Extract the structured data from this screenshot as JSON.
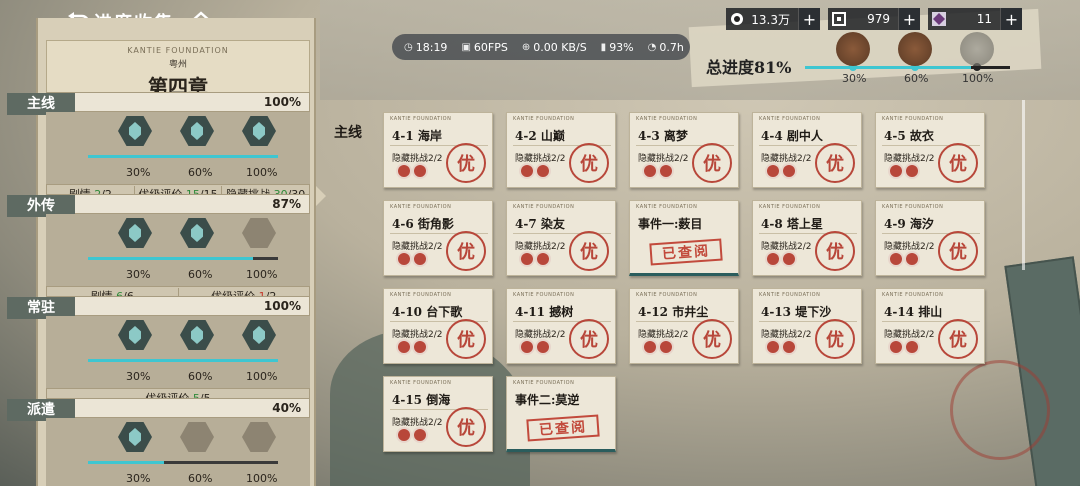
{
  "header": {
    "title": "进度收集",
    "back_icon": "back-arrow-icon",
    "home_icon": "home-icon"
  },
  "status": {
    "time": "18:19",
    "fps": "60FPS",
    "net": "0.00 KB/S",
    "battery": "93%",
    "ping": "0.7h"
  },
  "currencies": [
    {
      "icon": "coin-icon",
      "value": "13.3万",
      "plus": "+"
    },
    {
      "icon": "ticket-icon",
      "value": "979",
      "plus": "+"
    },
    {
      "icon": "crystal-icon",
      "value": "11",
      "plus": "+"
    }
  ],
  "total": {
    "label": "总进度81%",
    "progress": 0.81,
    "marks": [
      "30%",
      "60%",
      "100%"
    ]
  },
  "chapter": {
    "en": "KANTIE FOUNDATION",
    "region": "粤州",
    "title": "第四章"
  },
  "sections": [
    {
      "title": "主线",
      "pct": "100%",
      "marks": [
        "30%",
        "60%",
        "100%"
      ],
      "hex_on": [
        true,
        true,
        true
      ],
      "fill": 1.0,
      "stats": [
        {
          "label": "剧情 ",
          "val": "2",
          "tot": "/2"
        },
        {
          "label": "优级评价 ",
          "val": "15",
          "tot": "/15"
        },
        {
          "label": "隐藏挑战 ",
          "val": "30",
          "tot": "/30"
        }
      ]
    },
    {
      "title": "外传",
      "pct": "87%",
      "marks": [
        "30%",
        "60%",
        "100%"
      ],
      "hex_on": [
        true,
        true,
        false
      ],
      "fill": 0.87,
      "stats": [
        {
          "label": "剧情 ",
          "val": "6",
          "tot": "/6"
        },
        {
          "label": "优级评价 ",
          "val": "1",
          "tot": "/2"
        }
      ]
    },
    {
      "title": "常驻",
      "pct": "100%",
      "marks": [
        "30%",
        "60%",
        "100%"
      ],
      "hex_on": [
        true,
        true,
        true
      ],
      "fill": 1.0,
      "stats": [
        {
          "label": "优级评价 ",
          "val": "5",
          "tot": "/5"
        }
      ]
    },
    {
      "title": "派遣",
      "pct": "40%",
      "marks": [
        "30%",
        "60%",
        "100%"
      ],
      "hex_on": [
        true,
        false,
        false
      ],
      "fill": 0.4,
      "stats": []
    }
  ],
  "main_label": "主线",
  "card_tag": "KANTIE FOUNDATION",
  "hidden_label": "隐藏挑战2/2",
  "seal_text": "优",
  "viewed_text": "已查阅",
  "cards": [
    {
      "name": "4-1 海岸",
      "type": "stage"
    },
    {
      "name": "4-2 山巅",
      "type": "stage"
    },
    {
      "name": "4-3 离梦",
      "type": "stage"
    },
    {
      "name": "4-4 剧中人",
      "type": "stage"
    },
    {
      "name": "4-5 故衣",
      "type": "stage"
    },
    {
      "name": "4-6 街角影",
      "type": "stage"
    },
    {
      "name": "4-7 染友",
      "type": "stage"
    },
    {
      "name": "事件一:薮目",
      "type": "event"
    },
    {
      "name": "4-8 塔上星",
      "type": "stage"
    },
    {
      "name": "4-9 海汐",
      "type": "stage"
    },
    {
      "name": "4-10 台下歌",
      "type": "stage"
    },
    {
      "name": "4-11 撼树",
      "type": "stage"
    },
    {
      "name": "4-12 市井尘",
      "type": "stage"
    },
    {
      "name": "4-13 堤下沙",
      "type": "stage"
    },
    {
      "name": "4-14 排山",
      "type": "stage"
    },
    {
      "name": "4-15 倒海",
      "type": "stage"
    },
    {
      "name": "事件二:莫逆",
      "type": "event"
    }
  ]
}
